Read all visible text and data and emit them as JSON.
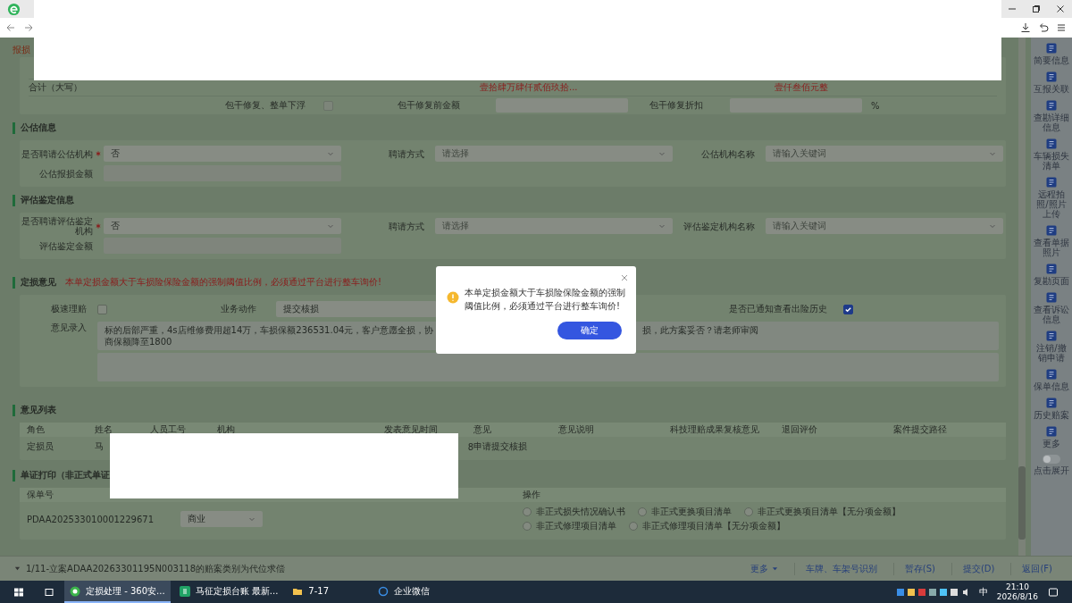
{
  "page": {
    "top_label": "报损",
    "total_row": {
      "label": "合计（大写）",
      "amount_1": "壹拾肆万肆仟贰佰玖拾...",
      "amount_2": "壹仟叁佰元整"
    },
    "package_row": {
      "checkbox_label": "包干修复、整单下浮",
      "checked": false,
      "amount_label": "包干修复前金额",
      "discount_label": "包干修复折扣",
      "unit": "%"
    }
  },
  "appraisal": {
    "title": "公估信息",
    "rows": [
      [
        {
          "label": "是否聘请公估机构",
          "required": true,
          "kind": "select",
          "value": "否"
        },
        {
          "label": "聘请方式",
          "required": false,
          "kind": "select",
          "placeholder": "请选择"
        },
        {
          "label": "公估机构名称",
          "required": false,
          "kind": "select",
          "placeholder": "请输入关键词"
        }
      ],
      [
        {
          "label": "公估报损金额",
          "required": false,
          "kind": "input"
        }
      ]
    ]
  },
  "evaluation": {
    "title": "评估鉴定信息",
    "rows": [
      [
        {
          "label": "是否聘请评估鉴定机构",
          "required": true,
          "kind": "select",
          "value": "否"
        },
        {
          "label": "聘请方式",
          "required": false,
          "kind": "select",
          "placeholder": "请选择"
        },
        {
          "label": "评估鉴定机构名称",
          "required": false,
          "kind": "select",
          "placeholder": "请输入关键词"
        }
      ],
      [
        {
          "label": "评估鉴定金额",
          "required": false,
          "kind": "input"
        }
      ]
    ]
  },
  "opinion": {
    "title": "定损意见",
    "warning": "本单定损金额大于车损险保险金额的强制阈值比例，必须通过平台进行整车询价!",
    "fast_claim": {
      "label": "极速理赔",
      "checked": false
    },
    "action": {
      "label": "业务动作",
      "value": "提交核损"
    },
    "history_notified": {
      "label": "是否已通知查看出险历史",
      "checked": true
    },
    "input": {
      "label": "意见录入",
      "visible_parts": [
        "标的后部严重，4s店维修费用超14万，车损保额236531.04元，客户意愿全损，协商保额降至1800",
        "损，此方案妥否？请老师审阅"
      ]
    }
  },
  "opinion_list": {
    "title": "意见列表",
    "columns": [
      "角色",
      "姓名",
      "人员工号",
      "机构",
      "发表意见时间",
      "意见",
      "意见说明",
      "科技理赔成果复核意见",
      "退回评价",
      "案件提交路径"
    ],
    "rows": [
      {
        "role": "定损员",
        "name": "马",
        "time": "8",
        "opinion": "申请提交核损"
      }
    ]
  },
  "print": {
    "title": "单证打印（非正式单证",
    "columns": [
      "保单号",
      "操作"
    ],
    "rows": [
      {
        "policy_no": "PDAA202533010001229671",
        "type": "商业",
        "options": [
          {
            "label": "非正式损失情况确认书",
            "selected": false
          },
          {
            "label": "非正式更换项目清单",
            "selected": false
          },
          {
            "label": "非正式更换项目清单【无分项金额】",
            "selected": false
          },
          {
            "label": "非正式修理项目清单",
            "selected": false
          },
          {
            "label": "非正式修理项目清单【无分项金额】",
            "selected": false
          }
        ]
      }
    ]
  },
  "sidebar": {
    "items": [
      "简要信息",
      "互报关联",
      "查勘详细信息",
      "车辆损失清单",
      "远程拍照/照片上传",
      "查看单据照片",
      "复勘页面",
      "查看诉讼信息",
      "注销/撤销申请",
      "保单信息",
      "历史赔案",
      "更多"
    ],
    "toggle": {
      "label": "点击展开",
      "on": false
    }
  },
  "bottom_bar": {
    "notice": "1/11-立案ADAA20263301195N003118的赔案类别为代位求偿",
    "more": "更多",
    "buttons": [
      "车牌、车架号识别",
      "暂存(S)",
      "提交(D)",
      "返回(F)"
    ]
  },
  "dialog": {
    "message": "本单定损金额大于车损险保险金额的强制阈值比例，必须通过平台进行整车询价!",
    "confirm": "确定"
  },
  "taskbar": {
    "items": [
      {
        "label": "定损处理 - 360安...",
        "selected": true
      },
      {
        "label": "马征定损台账 最新...",
        "selected": false
      },
      {
        "label": "7-17",
        "selected": false
      },
      {
        "label": "企业微信",
        "selected": false
      }
    ],
    "ime": "中",
    "time": "21:10",
    "date": "2026/8/16"
  }
}
